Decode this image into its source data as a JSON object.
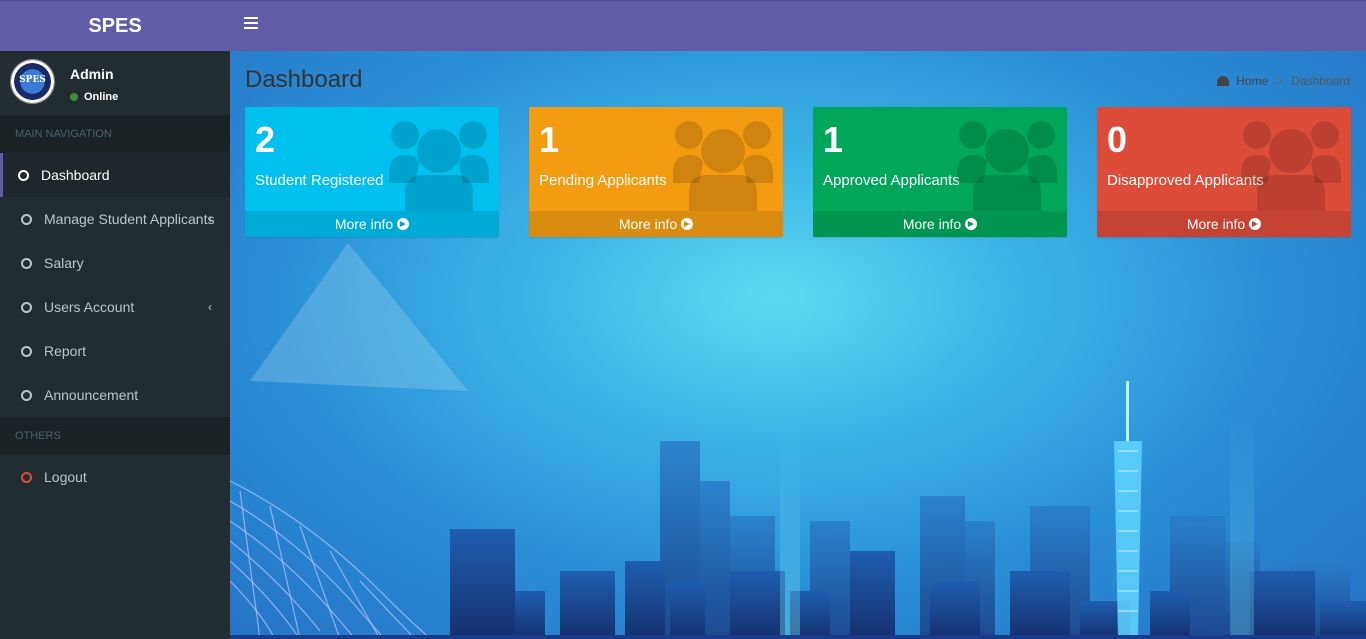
{
  "app": {
    "title": "SPES"
  },
  "user": {
    "name": "Admin",
    "status": "Online",
    "avatar_text": "SPES"
  },
  "sidebar": {
    "main_header": "MAIN NAVIGATION",
    "items": [
      {
        "label": "Dashboard",
        "active": true
      },
      {
        "label": "Manage Student Applicants",
        "has_submenu": true
      },
      {
        "label": "Salary"
      },
      {
        "label": "Users Account",
        "has_submenu": true
      },
      {
        "label": "Report"
      },
      {
        "label": "Announcement"
      }
    ],
    "others_header": "OTHERS",
    "logout_label": "Logout"
  },
  "header": {
    "menu_icon": "hamburger-icon"
  },
  "page": {
    "title": "Dashboard",
    "breadcrumb": {
      "home": "Home",
      "separator": ">",
      "current": "Dashboard"
    }
  },
  "stats": [
    {
      "value": "2",
      "label": "Student Registered",
      "more": "More info",
      "color": "#00c0ef"
    },
    {
      "value": "1",
      "label": "Pending Applicants",
      "more": "More info",
      "color": "#f39c12"
    },
    {
      "value": "1",
      "label": "Approved Applicants",
      "more": "More info",
      "color": "#00a65a"
    },
    {
      "value": "0",
      "label": "Disapproved Applicants",
      "more": "More info",
      "color": "#dd4b39"
    }
  ],
  "colors": {
    "brand": "#605ca8",
    "sidebar": "#222d32",
    "sidebar_dark": "#1a2226"
  }
}
